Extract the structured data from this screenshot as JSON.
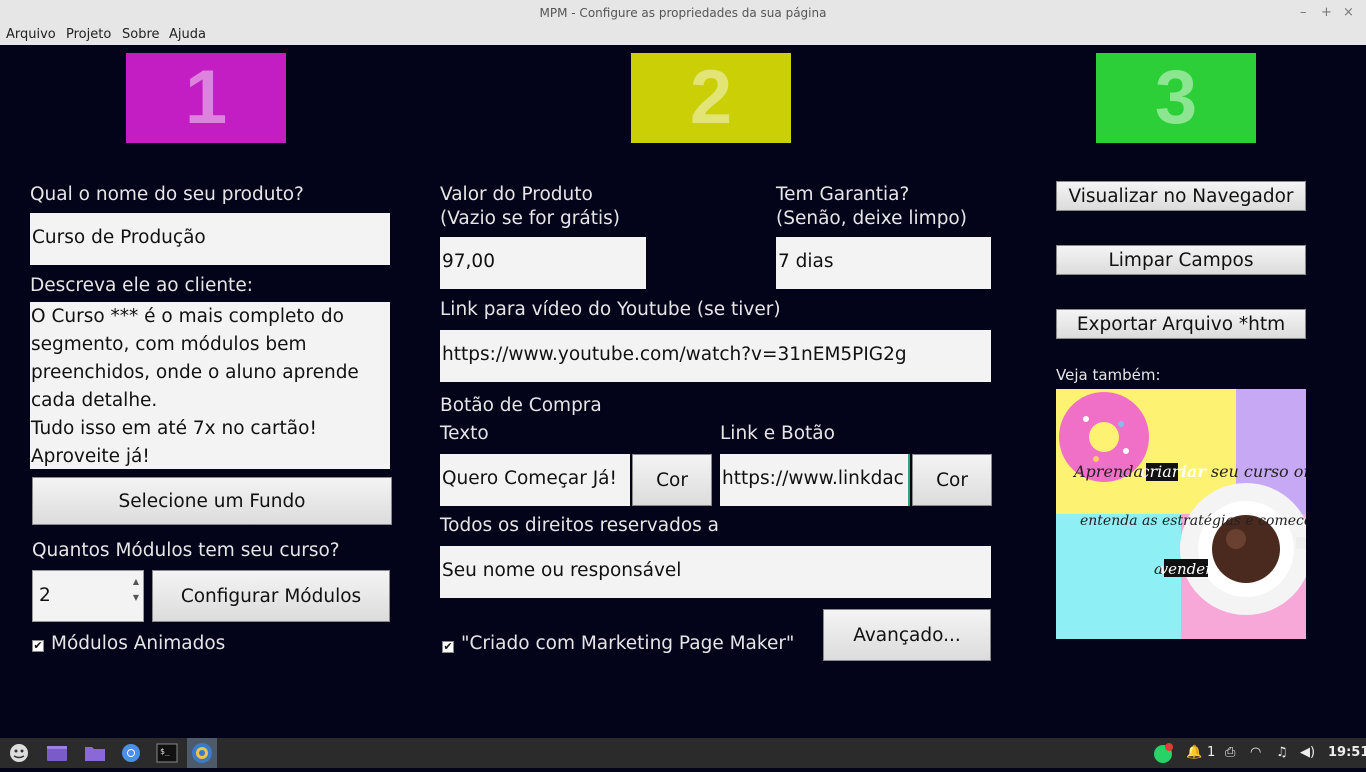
{
  "window": {
    "title": "MPM - Configure as propriedades da sua página",
    "controls": [
      "–",
      "+",
      "×"
    ]
  },
  "menu": [
    "Arquivo",
    "Projeto",
    "Sobre",
    "Ajuda"
  ],
  "steps": [
    {
      "number": "1",
      "color": "#c21ec3"
    },
    {
      "number": "2",
      "color": "#cbcf06"
    },
    {
      "number": "3",
      "color": "#2ccf37"
    }
  ],
  "col1": {
    "product_name_label": "Qual o nome do seu produto?",
    "product_name_value": "Curso de Produção",
    "description_label": "Descreva ele ao cliente:",
    "description_value": "O Curso *** é o mais completo do segmento, com módulos bem preenchidos, onde o aluno aprende cada detalhe.\nTudo isso em até 7x no cartão!\nAproveite já!",
    "background_button": "Selecione um Fundo",
    "modules_label": "Quantos Módulos tem seu curso?",
    "modules_value": "2",
    "configure_modules_button": "Configurar Módulos",
    "animated_modules_label": "Módulos Animados",
    "animated_modules_checked": "✔"
  },
  "col2": {
    "price_label": "Valor do Produto\n(Vazio se for grátis)",
    "price_value": "97,00",
    "warranty_label": "Tem Garantia?\n(Senão, deixe limpo)",
    "warranty_value": "7 dias",
    "youtube_label": "Link para vídeo do Youtube (se tiver)",
    "youtube_value": "https://www.youtube.com/watch?v=31nEM5PIG2g",
    "buy_button_label": "Botão de Compra",
    "text_label": "Texto",
    "text_value": "Quero Começar Já!",
    "color_button": "Cor",
    "link_label": "Link e Botão",
    "link_value": "https://www.linkdac",
    "link_color_button": "Cor",
    "rights_label": "Todos os direitos reservados a",
    "rights_value": "Seu nome ou responsável",
    "created_with_label": "\"Criado com Marketing Page Maker\"",
    "created_with_checked": "✔",
    "advanced_button": "Avançado..."
  },
  "col3": {
    "preview_button": "Visualizar no Navegador",
    "clear_button": "Limpar Campos",
    "export_button": "Exportar Arquivo *htm",
    "see_also_label": "Veja também:",
    "ad": {
      "line1a": "Aprenda a ",
      "line1b": "criar",
      "line1c": " seu curso online,",
      "line2": "entenda as estratégias e comece",
      "line3a": "a ",
      "line3b": "vender"
    }
  },
  "taskbar": {
    "tray_notifications": "1",
    "clock": "19:51"
  }
}
